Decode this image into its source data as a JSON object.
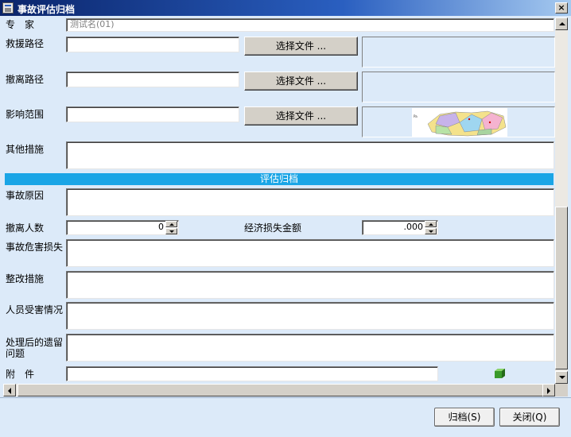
{
  "window": {
    "title": "事故评估归档",
    "close_label": "×"
  },
  "experts": {
    "label": "专　家",
    "value": "测试名(01)"
  },
  "rescue_route": {
    "label": "救援路径",
    "value": "",
    "button_label": "选择文件 ..."
  },
  "evacuation_route": {
    "label": "撤离路径",
    "value": "",
    "button_label": "选择文件 ..."
  },
  "impact_scope": {
    "label": "影响范围",
    "value": "",
    "button_label": "选择文件 ..."
  },
  "other_measures": {
    "label": "其他措施",
    "value": ""
  },
  "section_title": "评估归档",
  "accident_cause": {
    "label": "事故原因",
    "value": ""
  },
  "evacuees": {
    "label": "撤离人数",
    "value": "0"
  },
  "economic_loss": {
    "label": "经济损失金额",
    "value": ".000"
  },
  "accident_harm": {
    "label": "事故危害损失",
    "value": ""
  },
  "rectification": {
    "label": "整改措施",
    "value": ""
  },
  "casualties": {
    "label": "人员受害情况",
    "value": ""
  },
  "remaining_issues": {
    "label": "处理后的遗留问题",
    "value": ""
  },
  "attachment": {
    "label": "附　件",
    "value": "",
    "icon": "attachment-icon"
  },
  "buttons": {
    "archive": "归档(S)",
    "close": "关闭(Q)"
  },
  "colors": {
    "section_bar": "#1aa5e6",
    "window_bg": "#dceaf9",
    "title_start": "#0a246a"
  }
}
